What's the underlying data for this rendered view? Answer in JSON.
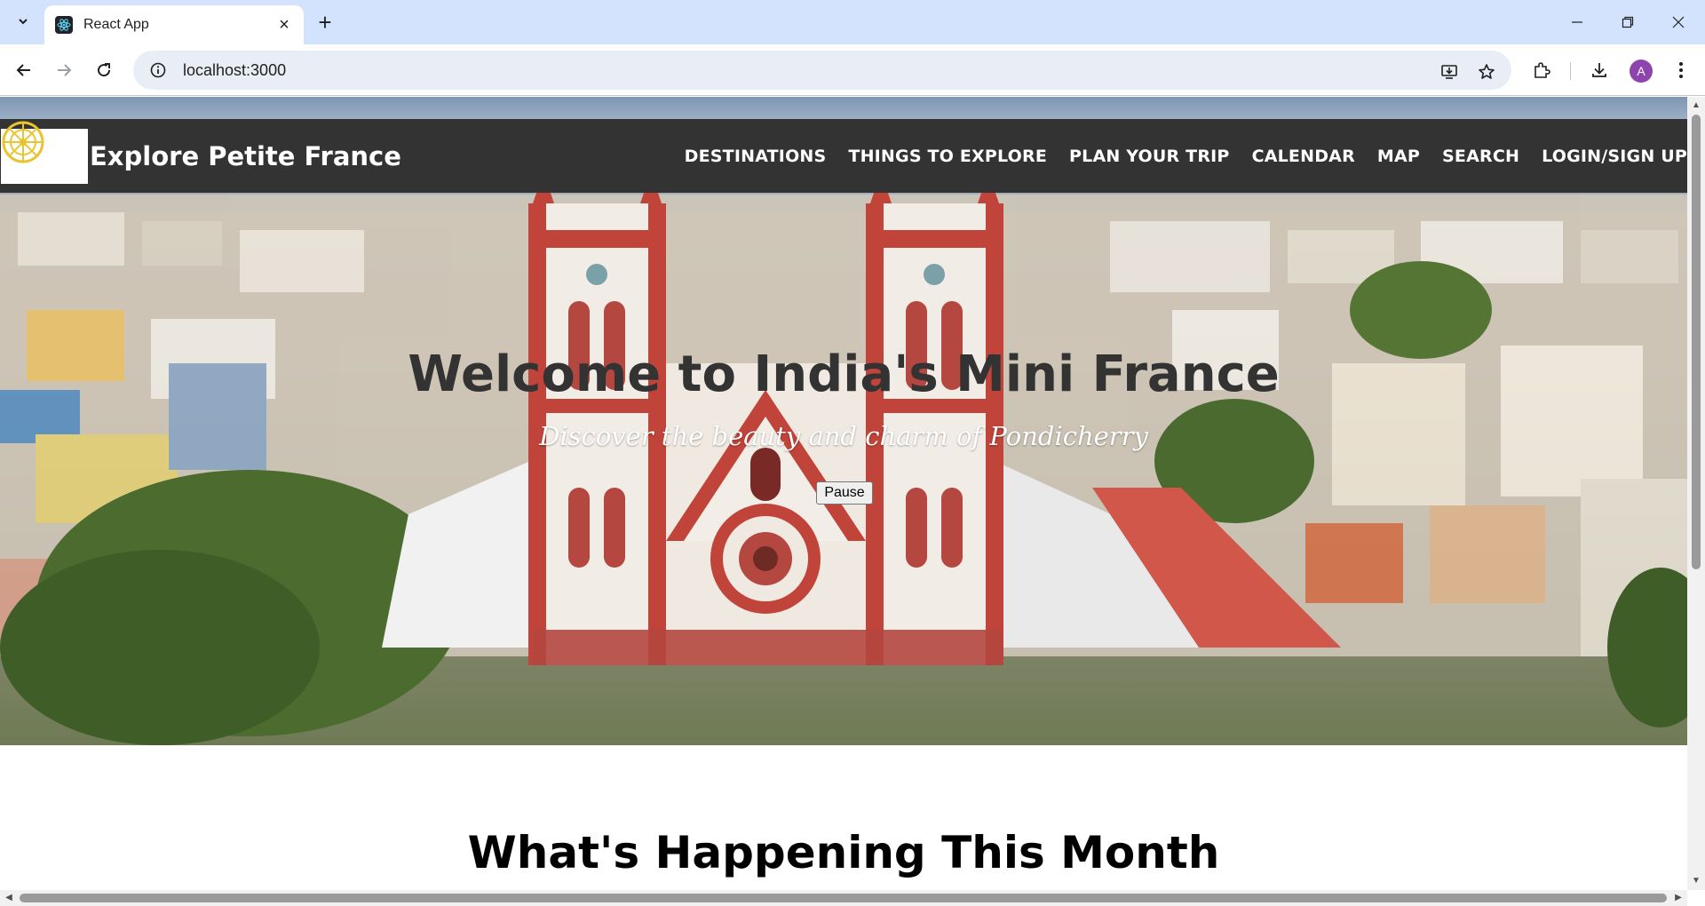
{
  "browser": {
    "tab_title": "React App",
    "url": "localhost:3000",
    "profile_initial": "A"
  },
  "site": {
    "title": "Explore Petite France",
    "nav": [
      "DESTINATIONS",
      "THINGS TO EXPLORE",
      "PLAN YOUR TRIP",
      "CALENDAR",
      "MAP",
      "SEARCH",
      "LOGIN/SIGN UP"
    ]
  },
  "hero": {
    "title": "Welcome to India's Mini France",
    "subtitle": "Discover the beauty and charm of Pondicherry",
    "pause_label": "Pause"
  },
  "section": {
    "title": "What's Happening This Month"
  },
  "colors": {
    "header_bg": "#333333",
    "tab_strip": "#d3e3fd",
    "church_red": "#c0443a"
  },
  "icons": [
    "tab-list-icon",
    "react-logo-icon",
    "close-icon",
    "plus-icon",
    "minimize-icon",
    "restore-icon",
    "back-icon",
    "forward-icon",
    "reload-icon",
    "info-icon",
    "install-icon",
    "star-icon",
    "extensions-icon",
    "download-icon",
    "menu-icon",
    "dharma-wheel-icon"
  ]
}
